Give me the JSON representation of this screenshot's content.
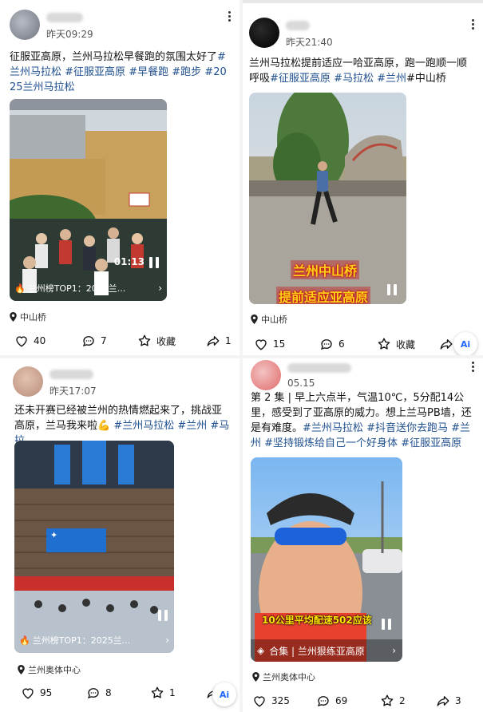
{
  "posts": [
    {
      "time": "昨天09:29",
      "text_parts": [
        {
          "t": "征服亚高原，兰州马拉松早餐跑的氛围太好了",
          "tag": false
        },
        {
          "t": "#兰州马拉松",
          "tag": true
        },
        {
          "t": " ",
          "tag": false
        },
        {
          "t": "#征服亚高原",
          "tag": true
        },
        {
          "t": " ",
          "tag": false
        },
        {
          "t": "#早餐跑",
          "tag": true
        },
        {
          "t": " ",
          "tag": false
        },
        {
          "t": "#跑步",
          "tag": true
        },
        {
          "t": " ",
          "tag": false
        },
        {
          "t": "#2025兰州马拉松",
          "tag": true
        }
      ],
      "duration": "01:13",
      "badge": "兰州榜TOP1：2025兰...",
      "location": "中山桥",
      "likes": "40",
      "comments": "7",
      "favorite_label": "收藏",
      "shares": "1"
    },
    {
      "time": "昨天21:40",
      "text_parts": [
        {
          "t": "兰州马拉松提前适应一哈亚高原，跑一跑顺一顺呼吸",
          "tag": false
        },
        {
          "t": "#征服亚高原",
          "tag": true
        },
        {
          "t": " ",
          "tag": false
        },
        {
          "t": "#马拉松",
          "tag": true
        },
        {
          "t": " ",
          "tag": false
        },
        {
          "t": "#兰州",
          "tag": true
        },
        {
          "t": "#中山桥",
          "tag": false
        }
      ],
      "overlay_line1": "兰州中山桥",
      "overlay_line2": "提前适应亚高原",
      "location": "中山桥",
      "likes": "15",
      "comments": "6",
      "favorite_label": "收藏",
      "ai_label": "Ai"
    },
    {
      "time": "昨天17:07",
      "text_parts": [
        {
          "t": "还未开赛已经被兰州的热情燃起来了，挑战亚高原，兰马我来啦💪 ",
          "tag": false
        },
        {
          "t": "#兰州马拉松",
          "tag": true
        },
        {
          "t": " ",
          "tag": false
        },
        {
          "t": "#兰州",
          "tag": true
        },
        {
          "t": " ",
          "tag": false
        },
        {
          "t": "#马拉...",
          "tag": true
        }
      ],
      "badge": "兰州榜TOP1：2025兰...",
      "location": "兰州奥体中心",
      "likes": "95",
      "comments": "8",
      "favorites": "1",
      "ai_label": "Ai"
    },
    {
      "time": "05.15",
      "text_parts": [
        {
          "t": "第 2 集 | 早上六点半，气温10℃，5分配14公里，感受到了亚高原的威力。想上兰马PB墙，还是有难度。",
          "tag": false
        },
        {
          "t": "#兰州马拉松",
          "tag": true
        },
        {
          "t": " ",
          "tag": false
        },
        {
          "t": "#抖音送你去跑马",
          "tag": true
        },
        {
          "t": " ",
          "tag": false
        },
        {
          "t": "#兰州",
          "tag": true
        },
        {
          "t": " ",
          "tag": false
        },
        {
          "t": "#坚持锻炼给自己一个好身体",
          "tag": true
        },
        {
          "t": " ",
          "tag": false
        },
        {
          "t": "#征服亚高原",
          "tag": true
        }
      ],
      "caption": "10公里平均配速502应该",
      "collection": "合集 | 兰州狠练亚高原",
      "location": "兰州奥体中心",
      "likes": "325",
      "comments": "69",
      "favorites": "2",
      "shares": "3"
    }
  ],
  "colors": {
    "hashtag": "#1f4f8f",
    "page_bg": "#f4f4f4"
  }
}
